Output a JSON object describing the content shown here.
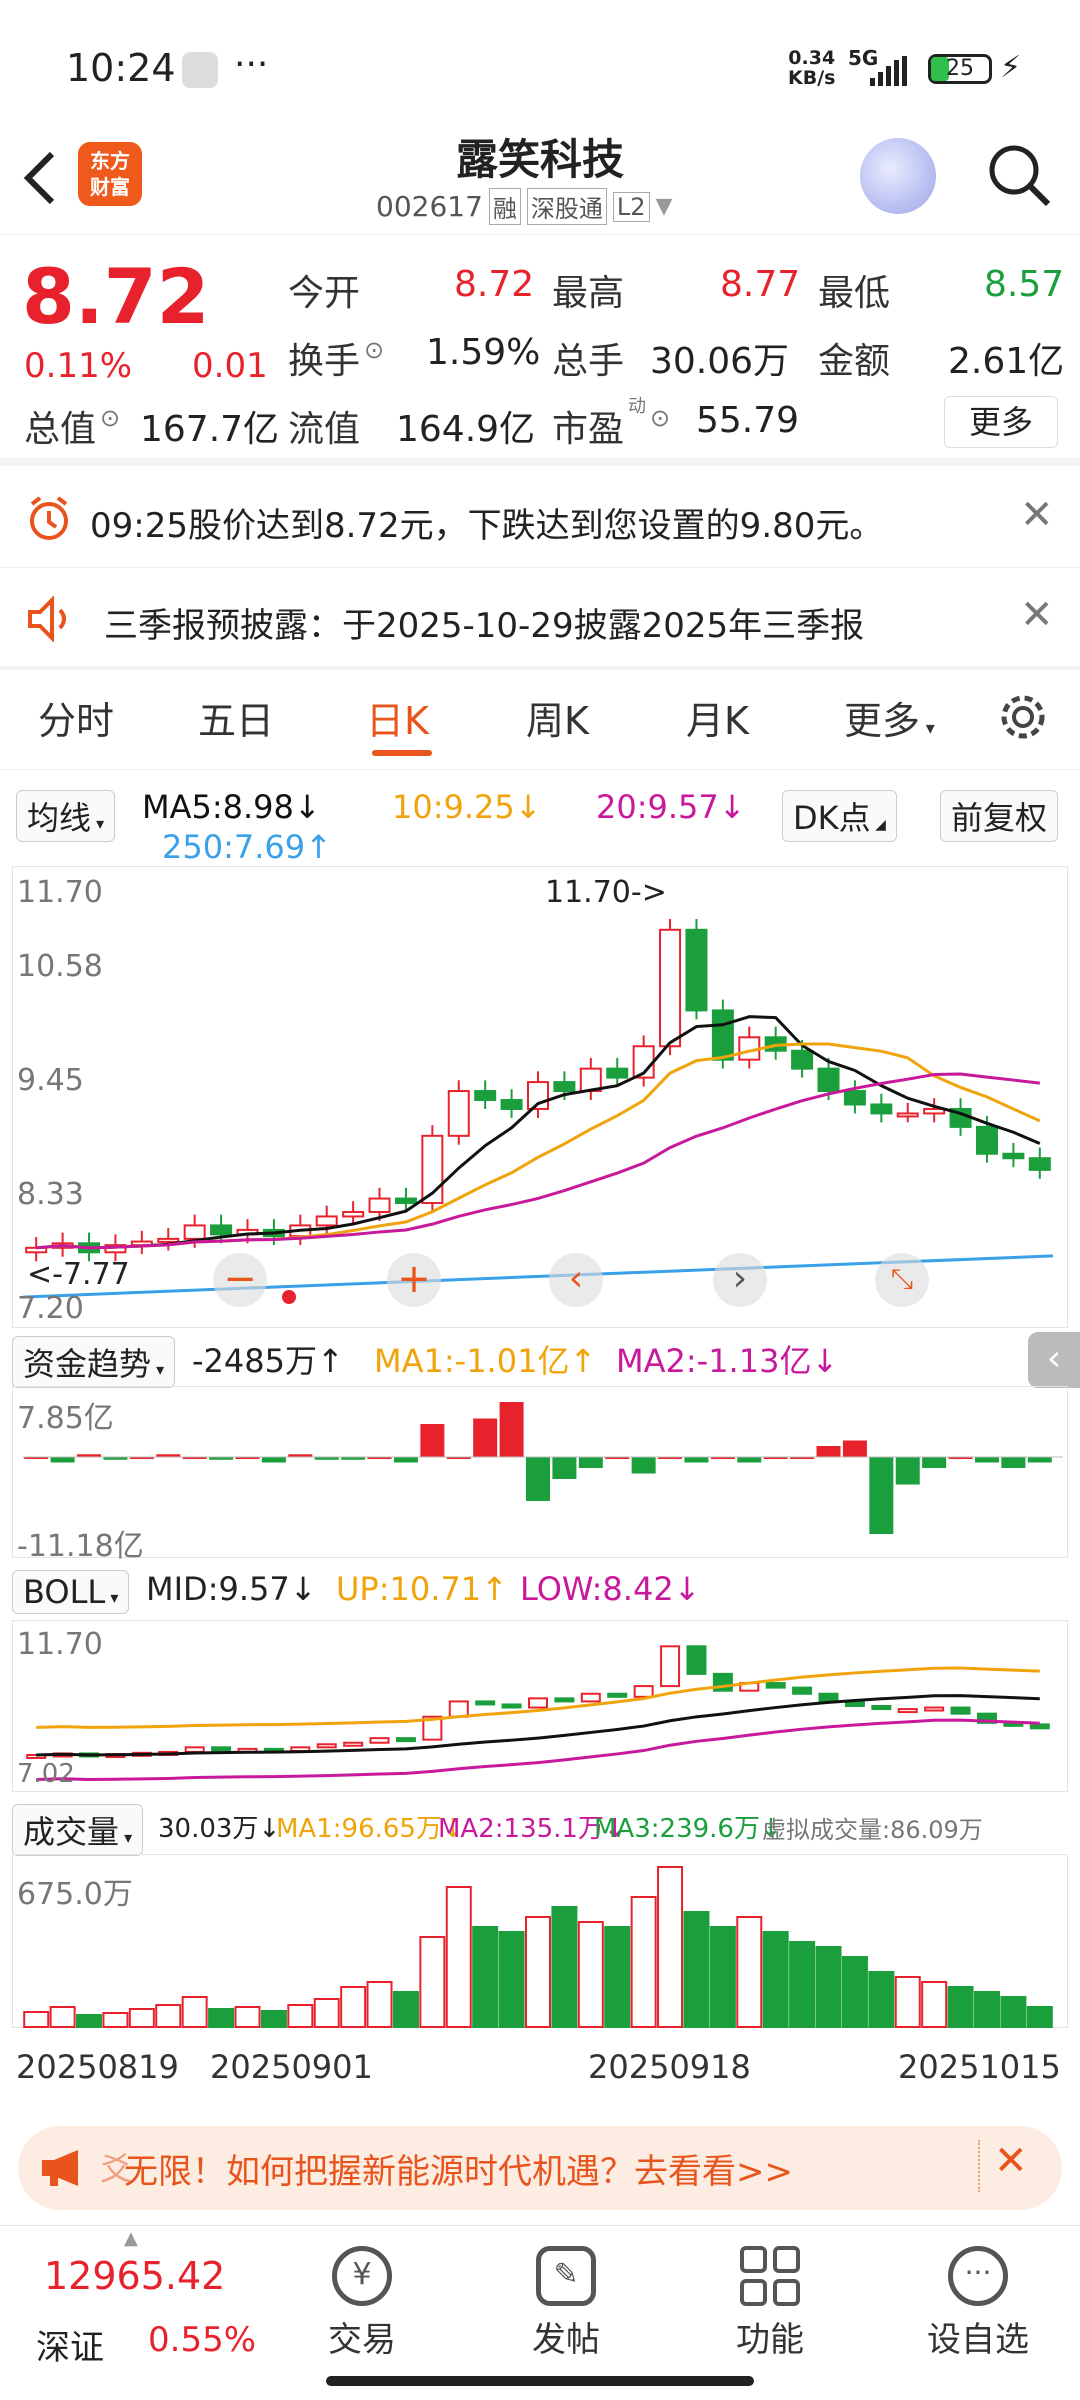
{
  "status_bar": {
    "time": "10:24",
    "speed": "0.34",
    "speed_unit": "KB/s",
    "network": "5G",
    "battery": "25"
  },
  "header": {
    "title": "露笑科技",
    "code": "002617",
    "tags": [
      "融",
      "深股通",
      "L2"
    ],
    "logo_line1": "东方",
    "logo_line2": "财富"
  },
  "quote": {
    "price": "8.72",
    "pct": "0.11%",
    "chg": "0.01",
    "open_label": "今开",
    "open": "8.72",
    "high_label": "最高",
    "high": "8.77",
    "low_label": "最低",
    "low": "8.57",
    "turnover_label": "换手",
    "turnover": "1.59%",
    "volume_label": "总手",
    "volume": "30.06万",
    "amount_label": "金额",
    "amount": "2.61亿",
    "mcap_label": "总值",
    "mcap": "167.7亿",
    "float_label": "流值",
    "float": "164.9亿",
    "pe_label": "市盈",
    "pe_sup": "动",
    "pe": "55.79",
    "more": "更多"
  },
  "alerts": [
    {
      "text": "09:25股价达到8.72元，下跌达到您设置的9.80元。"
    },
    {
      "text": "三季报预披露：于2025-10-29披露2025年三季报"
    }
  ],
  "tabs": [
    "分时",
    "五日",
    "日K",
    "周K",
    "月K",
    "更多"
  ],
  "active_tab": "日K",
  "ma_bar": {
    "selector": "均线",
    "ma5": "MA5:8.98",
    "ma10": "10:9.25",
    "ma20": "20:9.57",
    "ma250": "250:7.69",
    "dk": "DK点",
    "adjust": "前复权"
  },
  "kline": {
    "y_labels": [
      "11.70",
      "10.58",
      "9.45",
      "8.33",
      "7.20"
    ],
    "max_note": "11.70->",
    "min_note": "<-7.77"
  },
  "fund": {
    "selector": "资金趋势",
    "value": "-2485万",
    "ma1": "MA1:-1.01亿",
    "ma2": "MA2:-1.13亿",
    "top": "7.85亿",
    "bottom": "-11.18亿"
  },
  "boll": {
    "selector": "BOLL",
    "mid": "MID:9.57",
    "up": "UP:10.71",
    "low": "LOW:8.42",
    "top": "11.70",
    "bottom": "7.02"
  },
  "vol": {
    "selector": "成交量",
    "value": "30.03万",
    "ma1": "MA1:96.65万",
    "ma2": "MA2:135.1万",
    "ma3": "MA3:239.6万",
    "virtual": "虚拟成交量:86.09万",
    "top": "675.0万"
  },
  "dates": [
    "20250819",
    "20250901",
    "20250918",
    "20251015"
  ],
  "banner": {
    "text": "无限！如何把握新能源时代机遇？去看看>>",
    "prefix": "爻"
  },
  "bottom_nav": {
    "index_value": "12965.42",
    "index_name": "深证",
    "index_pct": "0.55%",
    "items": [
      "交易",
      "发帖",
      "功能",
      "设自选"
    ]
  },
  "colors": {
    "up": "#e8222c",
    "down": "#1a9f3c",
    "accent": "#e8541c",
    "ma5": "#111111",
    "ma10": "#f0a30a",
    "ma20": "#c8189c",
    "ma250": "#3aa0e8"
  }
}
